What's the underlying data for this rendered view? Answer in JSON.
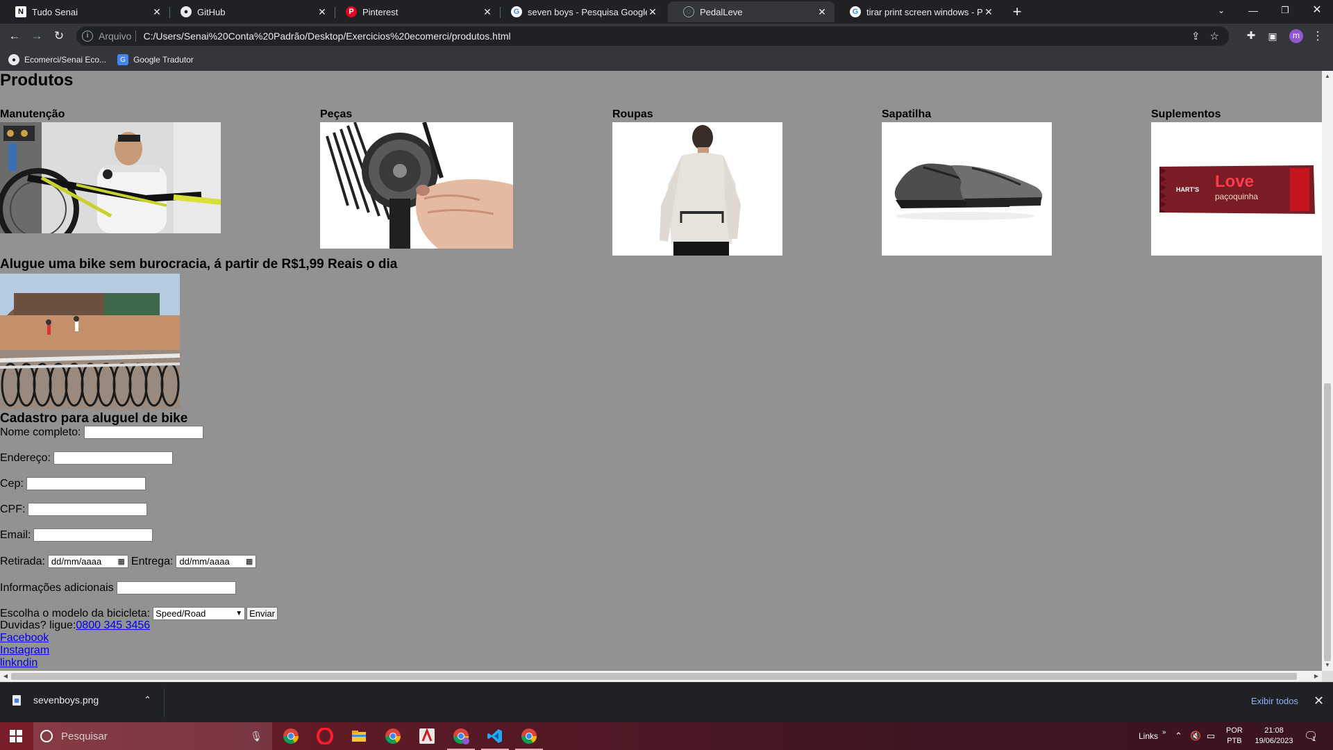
{
  "browser": {
    "tabs": [
      {
        "title": "Tudo Senai",
        "icon": "notion-icon"
      },
      {
        "title": "GitHub",
        "icon": "github-icon"
      },
      {
        "title": "Pinterest",
        "icon": "pinterest-icon"
      },
      {
        "title": "seven boys - Pesquisa Google",
        "icon": "google-icon"
      },
      {
        "title": "PedalLeve",
        "icon": "globe-icon",
        "active": true
      },
      {
        "title": "tirar print screen windows - Pesq",
        "icon": "google-icon"
      }
    ],
    "address": {
      "scheme_label": "Arquivo",
      "url": "C:/Users/Senai%20Conta%20Padrão/Desktop/Exercicios%20ecomerci/produtos.html"
    },
    "profile_initial": "m",
    "bookmarks": [
      {
        "label": "Ecomerci/Senai Eco...",
        "icon": "github-icon"
      },
      {
        "label": "Google Tradutor",
        "icon": "translate-icon"
      }
    ]
  },
  "page": {
    "heading": "Produtos",
    "categories": [
      {
        "label": "Manutenção"
      },
      {
        "label": "Peças"
      },
      {
        "label": "Roupas"
      },
      {
        "label": "Sapatilha"
      },
      {
        "label": "Suplementos"
      }
    ],
    "bar_text": {
      "brand": "HART'S",
      "name": "Love",
      "flavor": "paçoquinha"
    },
    "rent_heading": "Alugue uma bike sem burocracia, á partir de R$1,99 Reais o dia",
    "form": {
      "heading": "Cadastro para aluguel de bike",
      "fields": {
        "name": "Nome completo:",
        "address": "Endereço:",
        "cep": "Cep:",
        "cpf": "CPF:",
        "email": "Email:",
        "pickup": "Retirada:",
        "delivery": "Entrega:",
        "extra": "Informações adicionais",
        "model": "Escolha o modelo da bicicleta:"
      },
      "date_placeholder": "dd/mm/aaaa",
      "model_selected": "Speed/Road",
      "submit": "Enviar"
    },
    "contact": {
      "prefix": "Duvidas? ligue:",
      "phone": "0800 345 3456",
      "links": [
        "Facebook",
        "Instagram",
        "linkndin"
      ]
    }
  },
  "downloads": {
    "file": "sevenboys.png",
    "show_all": "Exibir todos"
  },
  "taskbar": {
    "search_placeholder": "Pesquisar",
    "links_label": "Links",
    "lang_top": "POR",
    "lang_bottom": "PTB",
    "time": "21:08",
    "date": "19/06/2023",
    "notifications": "1"
  },
  "colors": {
    "page_bg": "#929292",
    "link": "#0000ee",
    "chrome_dark": "#202124",
    "chrome_toolbar": "#35363a"
  }
}
